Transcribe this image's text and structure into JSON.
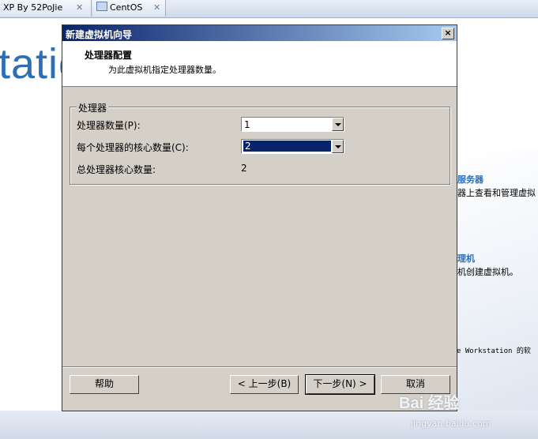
{
  "tabs": [
    {
      "label": "XP By 52PoJie"
    },
    {
      "label": "CentOS"
    }
  ],
  "background": {
    "title_fragment": "tatio",
    "items": [
      {
        "heading": "服务器",
        "text": "器上查看和管理虚拟"
      },
      {
        "heading": "理机",
        "text": "机创建虚拟机。"
      }
    ],
    "footer_text": "e Workstation 的软"
  },
  "dialog": {
    "title": "新建虚拟机向导",
    "close_glyph": "×",
    "header_title": "处理器配置",
    "header_subtitle": "为此虚拟机指定处理器数量。",
    "group_label": "处理器",
    "processor_count_label": "处理器数量(P):",
    "processor_count_value": "1",
    "cores_label": "每个处理器的核心数量(C):",
    "cores_value": "2",
    "total_cores_label": "总处理器核心数量:",
    "total_cores_value": "2",
    "buttons": {
      "help": "帮助",
      "back": "< 上一步(B)",
      "next": "下一步(N) >",
      "cancel": "取消"
    }
  },
  "watermark": {
    "text": "Bai 经验",
    "url": "jingyan.baidu.com"
  }
}
